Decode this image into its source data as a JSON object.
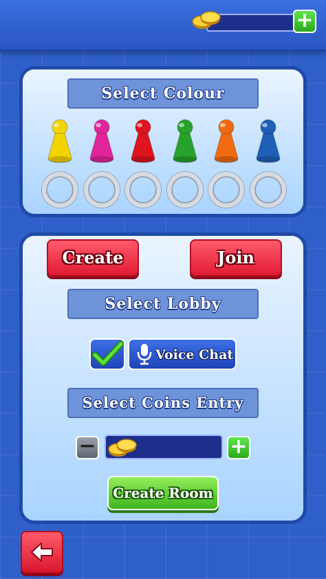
{
  "header": {
    "coins_icon": "gold-coins-icon",
    "add_icon": "plus-icon"
  },
  "colour_panel": {
    "title": "Select Colour",
    "pawns": [
      {
        "name": "yellow",
        "color": "#f4d400"
      },
      {
        "name": "pink",
        "color": "#e0249a"
      },
      {
        "name": "red",
        "color": "#e0141e"
      },
      {
        "name": "green",
        "color": "#27a32b"
      },
      {
        "name": "orange",
        "color": "#f26a10"
      },
      {
        "name": "blue",
        "color": "#1f5fb8"
      }
    ]
  },
  "lobby_panel": {
    "create_label": "Create",
    "join_label": "Join",
    "select_lobby": "Select Lobby",
    "voice_chat_label": "Voice Chat",
    "voice_chat_checked": true,
    "select_coins_entry": "Select Coins Entry",
    "create_room_label": "Create Room"
  },
  "colors": {
    "accent_red": "#e01b33",
    "accent_green": "#3fb51f",
    "panel_border": "#1f4aa8"
  }
}
